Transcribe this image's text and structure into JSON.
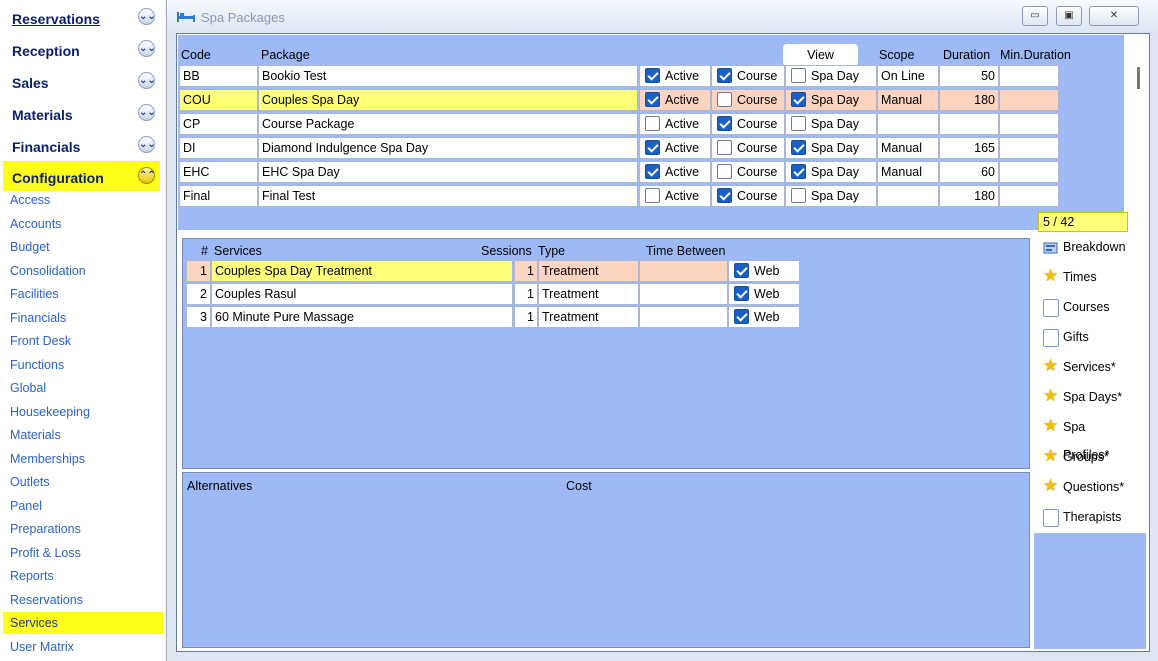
{
  "sidebar": {
    "sections": [
      {
        "label": "Reservations",
        "chev": "⌄⌄",
        "underline": true
      },
      {
        "label": "Reception",
        "chev": "⌄⌄"
      },
      {
        "label": "Sales",
        "chev": "⌄⌄"
      },
      {
        "label": "Materials",
        "chev": "⌄⌄"
      },
      {
        "label": "Financials",
        "chev": "⌄⌄"
      },
      {
        "label": "Configuration",
        "chev": "⌃⌃",
        "active": true
      }
    ],
    "items": [
      "Access",
      "Accounts",
      "Budget",
      "Consolidation",
      "Facilities",
      "Financials",
      "Front Desk",
      "Functions",
      "Global",
      "Housekeeping",
      "Materials",
      "Memberships",
      "Outlets",
      "Panel",
      "Preparations",
      "Profit & Loss",
      "Reports",
      "Reservations",
      "Services",
      "User Matrix"
    ],
    "selected_item": "Services"
  },
  "window": {
    "title": "Spa Packages",
    "buttons": {
      "minimize": "▭",
      "maximize": "▣",
      "close": "✕"
    }
  },
  "packages": {
    "headers": {
      "code": "Code",
      "package": "Package",
      "view": "View",
      "scope": "Scope",
      "duration": "Duration",
      "min_duration": "Min.Duration"
    },
    "labels": {
      "active": "Active",
      "course": "Course",
      "spa_day": "Spa Day"
    },
    "rows": [
      {
        "code": "BB",
        "package": "Bookio Test",
        "active": true,
        "course": true,
        "spa_day": false,
        "scope": "On Line",
        "duration": "50",
        "min_duration": ""
      },
      {
        "code": "COU",
        "package": "Couples Spa Day",
        "active": true,
        "course": false,
        "spa_day": true,
        "scope": "Manual",
        "duration": "180",
        "min_duration": "",
        "selected": true
      },
      {
        "code": "CP",
        "package": "Course Package",
        "active": false,
        "course": true,
        "spa_day": false,
        "scope": "",
        "duration": "",
        "min_duration": ""
      },
      {
        "code": "DI",
        "package": "Diamond Indulgence Spa Day",
        "active": true,
        "course": false,
        "spa_day": true,
        "scope": "Manual",
        "duration": "165",
        "min_duration": ""
      },
      {
        "code": "EHC",
        "package": "EHC Spa Day",
        "active": true,
        "course": false,
        "spa_day": true,
        "scope": "Manual",
        "duration": "60",
        "min_duration": ""
      },
      {
        "code": "Final",
        "package": "Final Test",
        "active": false,
        "course": true,
        "spa_day": false,
        "scope": "",
        "duration": "180",
        "min_duration": ""
      }
    ],
    "record_counter": "5 / 42"
  },
  "services": {
    "headers": {
      "num": "#",
      "services": "Services",
      "sessions": "Sessions",
      "type": "Type",
      "time_between": "Time Between"
    },
    "web_label": "Web",
    "rows": [
      {
        "num": "1",
        "service": "Couples Spa Day Treatment",
        "sessions": "1",
        "type": "Treatment",
        "time_between": "",
        "web": true,
        "selected": true
      },
      {
        "num": "2",
        "service": "Couples Rasul",
        "sessions": "1",
        "type": "Treatment",
        "time_between": "",
        "web": true
      },
      {
        "num": "3",
        "service": "60 Minute Pure Massage",
        "sessions": "1",
        "type": "Treatment",
        "time_between": "",
        "web": true
      }
    ]
  },
  "alternatives": {
    "label": "Alternatives",
    "cost_label": "Cost"
  },
  "right_buttons": [
    {
      "label": "Breakdown",
      "icon": "breakdown-icon"
    },
    {
      "label": "Times",
      "icon": "star-icon"
    },
    {
      "label": "Courses",
      "icon": "page-icon"
    },
    {
      "label": "Gifts",
      "icon": "page-icon"
    },
    {
      "label": "Services*",
      "icon": "star-icon"
    },
    {
      "label": "Spa Days*",
      "icon": "star-icon"
    },
    {
      "label": "Spa Profiles*",
      "icon": "star-icon"
    },
    {
      "label": "Groups*",
      "icon": "star-icon"
    },
    {
      "label": "Questions*",
      "icon": "star-icon"
    },
    {
      "label": "Therapists",
      "icon": "page-icon"
    }
  ],
  "colors": {
    "panel": "#9dbaf6",
    "highlight": "#ffff1a",
    "selected_pink": "#fcd4c0",
    "checkbox": "#1a5fc2"
  }
}
